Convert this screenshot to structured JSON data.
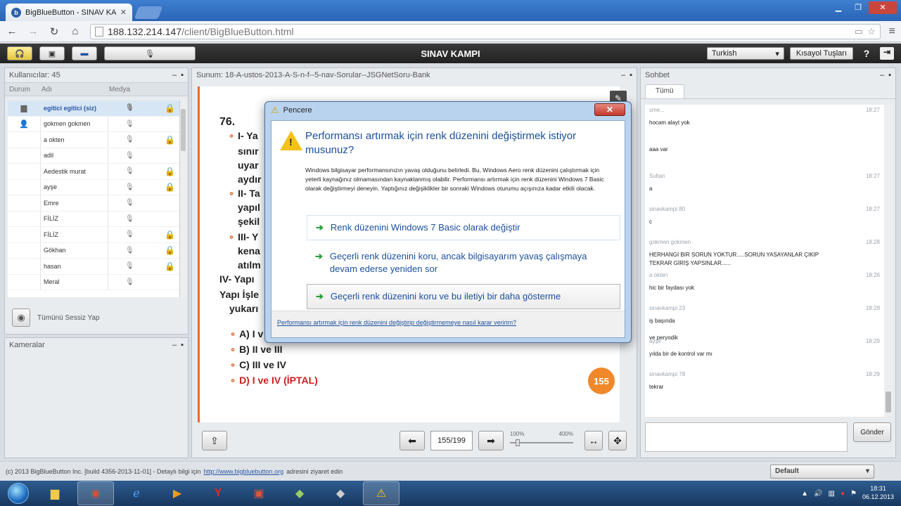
{
  "browser": {
    "tab_title": "BigBlueButton - SINAV KAMPI",
    "url_host": "188.132.214.147",
    "url_path": "/client/BigBlueButton.html"
  },
  "app": {
    "title": "SINAV KAMPI",
    "language": "Turkish",
    "shortcuts_label": "Kısayol Tuşları",
    "help_label": "?"
  },
  "users": {
    "header": "Kullanıcılar: 45",
    "col_status": "Durum",
    "col_name": "Adı",
    "col_media": "Medya",
    "rows": [
      {
        "name": "egitici egitici (siz)",
        "locked": true,
        "selected": true
      },
      {
        "name": "gokmen gokmen",
        "locked": false,
        "selected": false
      },
      {
        "name": "a okten",
        "locked": true,
        "selected": false
      },
      {
        "name": "adil",
        "locked": false,
        "selected": false
      },
      {
        "name": "Aedestik murat",
        "locked": true,
        "selected": false
      },
      {
        "name": "ayşe",
        "locked": true,
        "selected": false
      },
      {
        "name": "Emre",
        "locked": false,
        "selected": false
      },
      {
        "name": "FİLİZ",
        "locked": false,
        "selected": false
      },
      {
        "name": "FİLİZ",
        "locked": true,
        "selected": false
      },
      {
        "name": "Gökhan",
        "locked": true,
        "selected": false
      },
      {
        "name": "hasan",
        "locked": true,
        "selected": false
      },
      {
        "name": "Meral",
        "locked": false,
        "selected": false
      }
    ],
    "mute_all_label": "Tümünü Sessiz Yap"
  },
  "cameras": {
    "header": "Kameralar"
  },
  "presentation": {
    "header": "Sunum: 18-A-ustos-2013-A-S-n-f--5-nav-Sorular--JSGNetSoru-Bank",
    "question_number": "76.",
    "lines": [
      {
        "text": "I- Ya",
        "bullet": true
      },
      {
        "text": "sınır",
        "bullet": false
      },
      {
        "text": "uyar",
        "bullet": false
      },
      {
        "text": "aydır",
        "bullet": false
      },
      {
        "text": "II- Ta",
        "bullet": true
      },
      {
        "text": "yapıl",
        "bullet": false
      },
      {
        "text": "şekil",
        "bullet": false
      },
      {
        "text": "III- Y",
        "bullet": true
      },
      {
        "text": "kena",
        "bullet": false
      },
      {
        "text": "atılm",
        "bullet": false
      },
      {
        "text": "IV- Yapı",
        "bullet": false
      },
      {
        "text": "Yapı İşle",
        "bullet": false
      },
      {
        "text": "yukarı",
        "bullet": false
      }
    ],
    "options": [
      {
        "text": "A) I v",
        "red": false
      },
      {
        "text": "B) II ve III",
        "red": false
      },
      {
        "text": "C) III ve IV",
        "red": false
      },
      {
        "text": "D) I ve IV (İPTAL)",
        "red": true
      }
    ],
    "slide_badge": "155",
    "page_indicator": "155/199",
    "zoom_min": "100%",
    "zoom_max": "400%",
    "zoom_level": 0.1
  },
  "chat": {
    "header": "Sohbet",
    "tab": "Tümü",
    "messages": [
      {
        "sender": "sme...",
        "time": "18:27",
        "text": "hocam alayt yok"
      },
      {
        "sender": "",
        "time": "",
        "text": "aaa var"
      },
      {
        "sender": "Sultan",
        "time": "18:27",
        "text": "a"
      },
      {
        "sender": "sinavkampi 80",
        "time": "18:27",
        "text": "c"
      },
      {
        "sender": "gokmen gokmen",
        "time": "18:28",
        "text": "HERHANGI BIR SORUN YOKTUR.....SORUN YASAYANLAR ÇIKIP\nTEKRAR GİRİŞ YAPSINLAR......"
      },
      {
        "sender": "a okten",
        "time": "18:26",
        "text": "hic bir faydası yok"
      },
      {
        "sender": "sinavkampi 23",
        "time": "18:28",
        "text": "iş başında\n\nve peryodik"
      },
      {
        "sender": "ayşe",
        "time": "18:29",
        "text": "yılda bir de kontrol var mı"
      },
      {
        "sender": "sinavkampi 78",
        "time": "18:29",
        "text": "tekrar"
      }
    ],
    "send_label": "Gönder"
  },
  "footer": {
    "text": "(c) 2013 BigBlueButton Inc. [build 4356-2013-11-01] - Detaylı bilgi için",
    "link": "http://www.bigbluebutton.org",
    "suffix": "adresini ziyaret edin",
    "layout": "Default"
  },
  "taskbar": {
    "time": "18:31",
    "date": "06.12.2013"
  },
  "dialog": {
    "title": "Pencere",
    "heading": "Performansı artırmak için renk düzenini değiştirmek istiyor musunuz?",
    "body": "Windows bilgisayar performansınızın yavaş olduğunu belirledi. Bu, Windows Aero renk düzenini çalıştırmak için yeterli kaynağınız olmamasından kaynaklanmış olabilir. Performansı artırmak için renk düzenini Windows 7 Basic olarak değiştirmeyi deneyin. Yaptığınız değişiklikler bir sonraki Windows oturumu açışınıza kadar etkili olacak.",
    "option1": "Renk düzenini Windows 7 Basic olarak değiştir",
    "option2": "Geçerli renk düzenini koru, ancak bilgisayarım yavaş çalışmaya devam ederse yeniden sor",
    "option3": "Geçerli renk düzenini koru ve bu iletiyi bir daha gösterme",
    "help_link": "Performansı artırmak için renk düzenini değiştirip değiştirmemeye nasıl karar veririm?"
  }
}
